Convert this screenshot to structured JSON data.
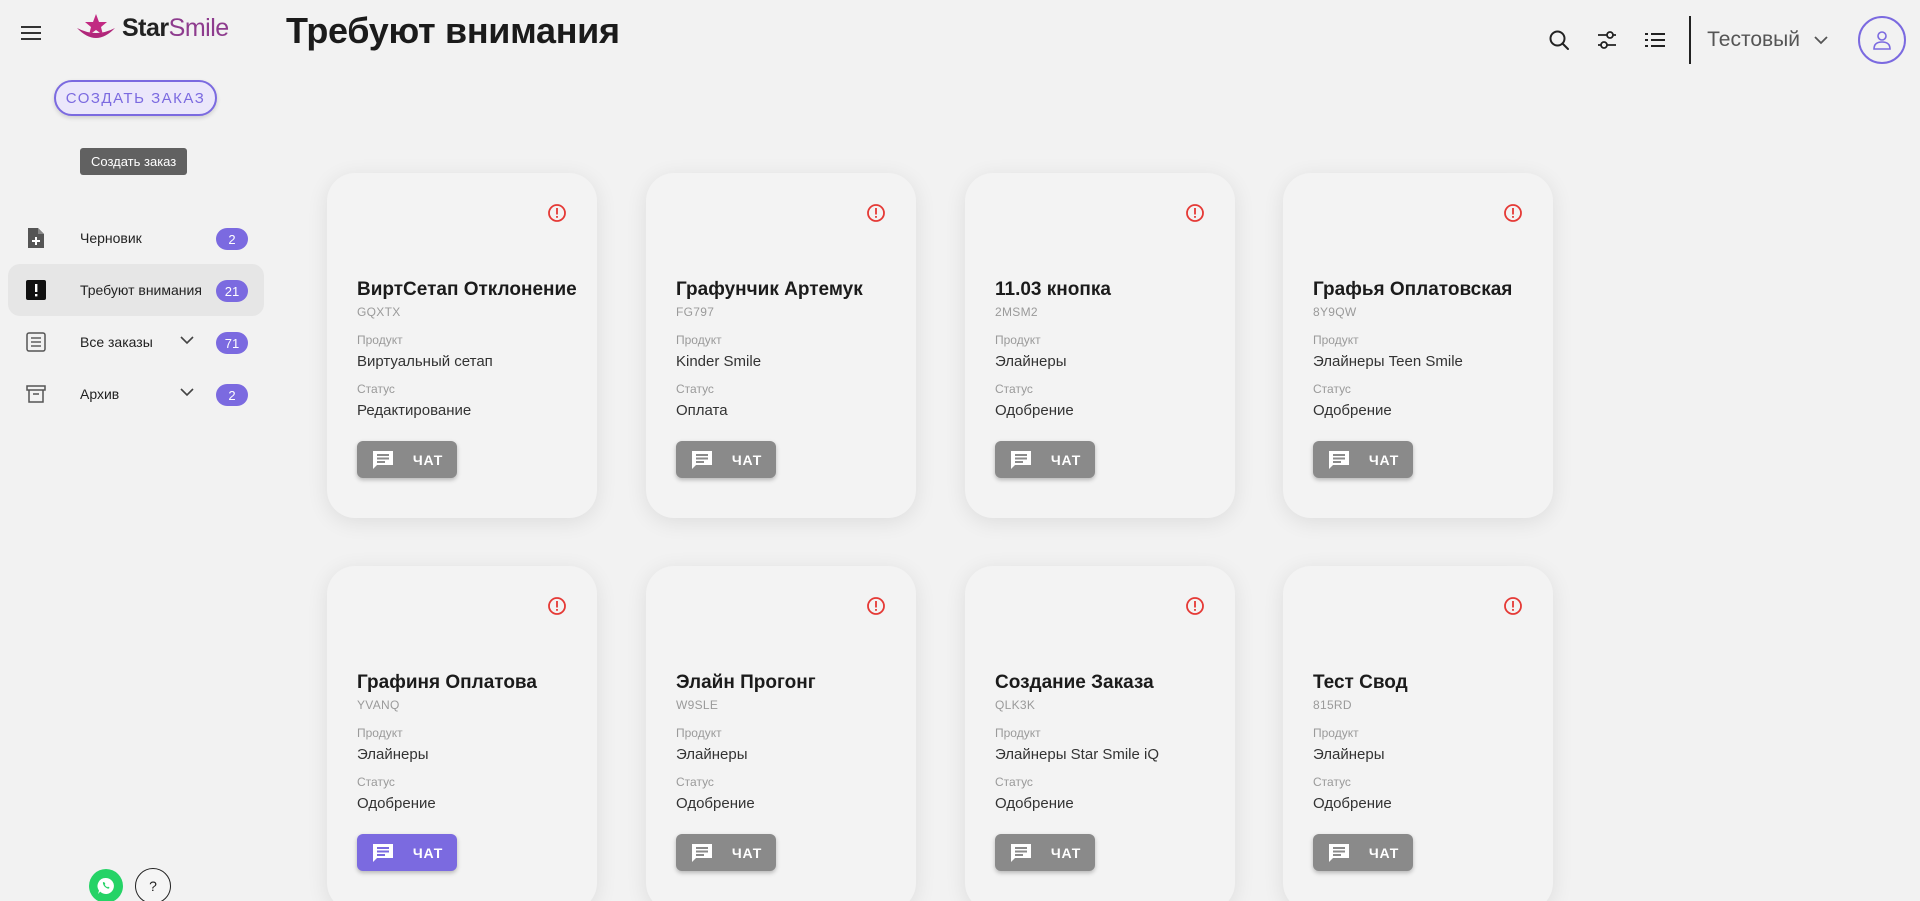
{
  "app": {
    "logo_star": "Star",
    "logo_smile": "Smile",
    "page_title": "Требуют внимания",
    "workspace": "Тестовый"
  },
  "sidebar": {
    "create_button": "СОЗДАТЬ ЗАКАЗ",
    "create_tooltip": "Создать заказ",
    "items": [
      {
        "label": "Черновик",
        "count": "2",
        "icon": "draft-add-icon",
        "active": false,
        "expandable": false
      },
      {
        "label": "Требуют внимания",
        "count": "21",
        "icon": "alert-square-icon",
        "active": true,
        "expandable": false
      },
      {
        "label": "Все заказы",
        "count": "71",
        "icon": "list-icon",
        "active": false,
        "expandable": true
      },
      {
        "label": "Архив",
        "count": "2",
        "icon": "archive-icon",
        "active": false,
        "expandable": true
      }
    ],
    "help_label": "?"
  },
  "card_labels": {
    "product": "Продукт",
    "status": "Статус",
    "chat": "ЧАТ"
  },
  "orders": [
    {
      "name": "ВиртСетап Отклонение",
      "code": "GQXTX",
      "product": "Виртуальный сетап",
      "status": "Редактирование",
      "chat_active": false
    },
    {
      "name": "Графунчик Артемук",
      "code": "FG797",
      "product": "Kinder Smile",
      "status": "Оплата",
      "chat_active": false
    },
    {
      "name": "11.03 кнопка",
      "code": "2MSM2",
      "product": "Элайнеры",
      "status": "Одобрение",
      "chat_active": false
    },
    {
      "name": "Графья Оплатовская",
      "code": "8Y9QW",
      "product": "Элайнеры Teen Smile",
      "status": "Одобрение",
      "chat_active": false
    },
    {
      "name": "Графиня Оплатова",
      "code": "YVANQ",
      "product": "Элайнеры",
      "status": "Одобрение",
      "chat_active": true
    },
    {
      "name": "Элайн Прогонг",
      "code": "W9SLE",
      "product": "Элайнеры",
      "status": "Одобрение",
      "chat_active": false
    },
    {
      "name": "Создание Заказа",
      "code": "QLK3K",
      "product": "Элайнеры Star Smile iQ",
      "status": "Одобрение",
      "chat_active": false
    },
    {
      "name": "Тест Свод",
      "code": "815RD",
      "product": "Элайнеры",
      "status": "Одобрение",
      "chat_active": false
    }
  ],
  "colors": {
    "accent": "#7b6ae0",
    "alert": "#e53935",
    "chat_default": "#8a8a8a",
    "brand_smile": "#8e3c8e",
    "whatsapp": "#25d366"
  }
}
